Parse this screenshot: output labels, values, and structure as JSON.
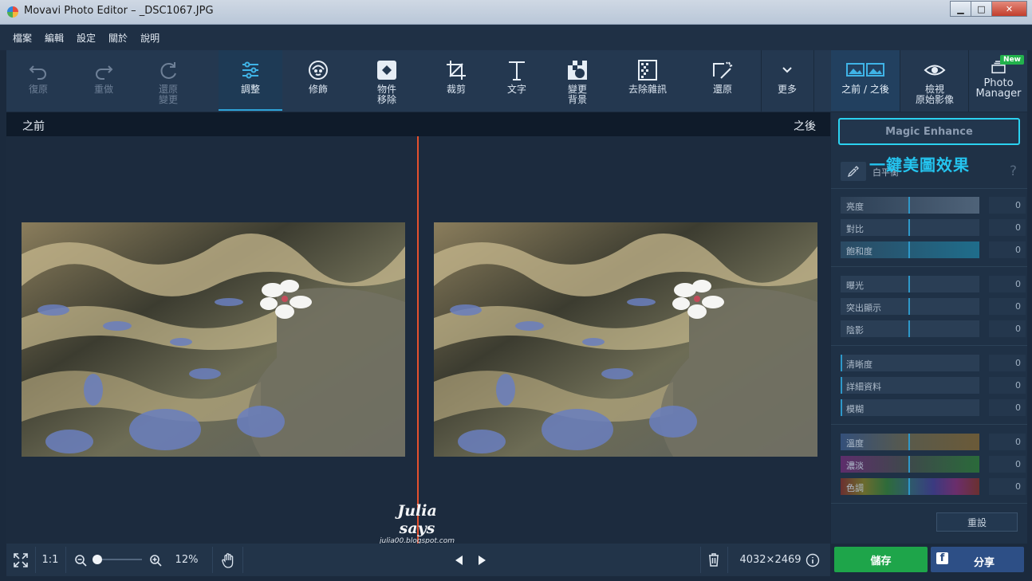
{
  "window": {
    "title": "Movavi Photo Editor – _DSC1067.JPG",
    "min": "▁",
    "max": "□",
    "close": "✕"
  },
  "menu": [
    "檔案",
    "編輯",
    "設定",
    "關於",
    "說明"
  ],
  "toolbar": {
    "undo": "復原",
    "redo": "重做",
    "restore": "還原\n變更",
    "adjust": "調整",
    "retouch": "修飾",
    "object_removal": "物件\n移除",
    "crop": "裁剪",
    "text": "文字",
    "change_bg": "變更\n背景",
    "denoise": "去除雜訊",
    "restoration": "還原",
    "more": "更多",
    "before_after": "之前 / 之後",
    "view_original": "檢視\n原始影像",
    "photo_manager": "Photo\nManager",
    "new_badge": "New"
  },
  "viewer": {
    "before": "之前",
    "after": "之後"
  },
  "watermark": {
    "title": "Julia says",
    "url": "julia00.blogspot.com"
  },
  "bottombar": {
    "one_to_one": "1:1",
    "zoom": "12%",
    "dimensions": "4032×2469"
  },
  "panel": {
    "magic_enhance": "Magic Enhance",
    "annotation": "一鍵美圖效果",
    "white_balance": "白平衡",
    "help": "?",
    "reset": "重設",
    "sliders": [
      {
        "name": "亮度",
        "value": "0"
      },
      {
        "name": "對比",
        "value": "0"
      },
      {
        "name": "飽和度",
        "value": "0"
      },
      {
        "name": "曝光",
        "value": "0"
      },
      {
        "name": "突出顯示",
        "value": "0"
      },
      {
        "name": "陰影",
        "value": "0"
      },
      {
        "name": "清晰度",
        "value": "0"
      },
      {
        "name": "詳細資料",
        "value": "0"
      },
      {
        "name": "模糊",
        "value": "0"
      },
      {
        "name": "溫度",
        "value": "0"
      },
      {
        "name": "濃淡",
        "value": "0"
      },
      {
        "name": "色調",
        "value": "0"
      }
    ]
  },
  "actions": {
    "save": "儲存",
    "share": "分享",
    "fb": "f"
  },
  "colors": {
    "accent": "#2ea3d8",
    "highlight": "#2bd2f0",
    "divider": "#e4502e",
    "save": "#1ea54a",
    "share": "#2d4f86"
  }
}
